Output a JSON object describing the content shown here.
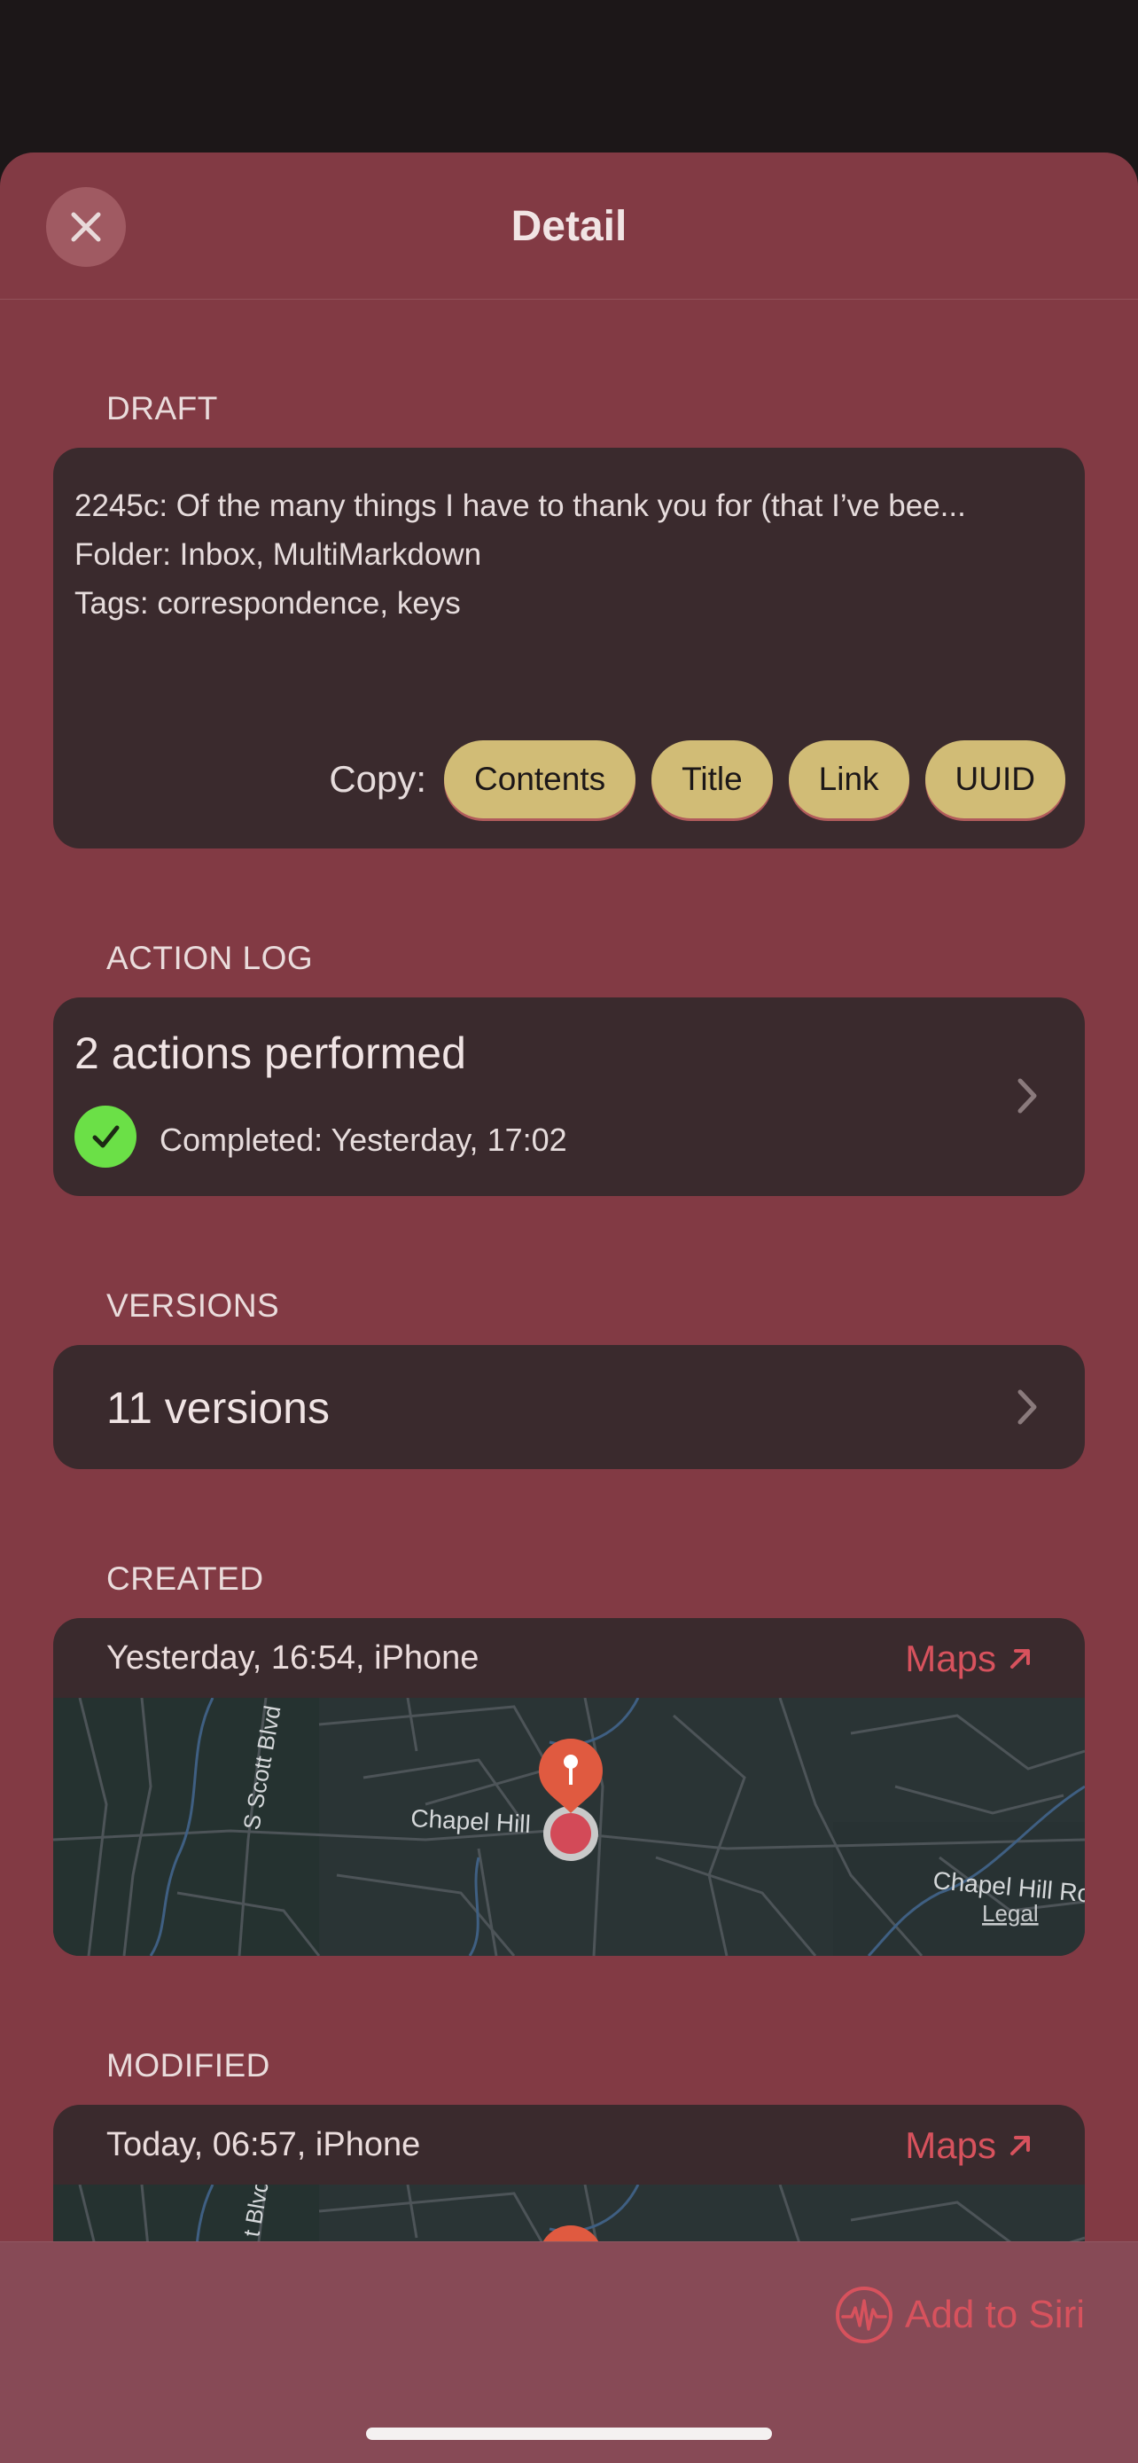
{
  "header": {
    "title": "Detail"
  },
  "draft": {
    "section_label": "DRAFT",
    "line1": "2245c: Of the many things I have to thank you for (that I’ve bee...",
    "line2": "Folder: Inbox, MultiMarkdown",
    "line3": "Tags: correspondence, keys",
    "copy_label": "Copy:",
    "copy_buttons": [
      "Contents",
      "Title",
      "Link",
      "UUID"
    ]
  },
  "action_log": {
    "section_label": "ACTION LOG",
    "title": "2 actions performed",
    "status": "Completed: Yesterday, 17:02",
    "status_color": "#6be047"
  },
  "versions": {
    "section_label": "VERSIONS",
    "title": "11 versions"
  },
  "created": {
    "section_label": "CREATED",
    "info": "Yesterday, 16:54, iPhone",
    "maps_label": "Maps",
    "map_labels": {
      "road1": "S Scott Blvd",
      "road2": "Chapel Hill",
      "road3": "Chapel Hill Ro",
      "legal": "Legal"
    }
  },
  "modified": {
    "section_label": "MODIFIED",
    "info": "Today, 06:57, iPhone",
    "maps_label": "Maps",
    "map_labels": {
      "road1": "t Blvd"
    }
  },
  "footer": {
    "siri_label": "Add to Siri"
  },
  "colors": {
    "sheet": "#823a44",
    "card": "#3a2a2d",
    "accent": "#d7525d",
    "pill": "#d1bc76",
    "pin": "#e05a40"
  }
}
